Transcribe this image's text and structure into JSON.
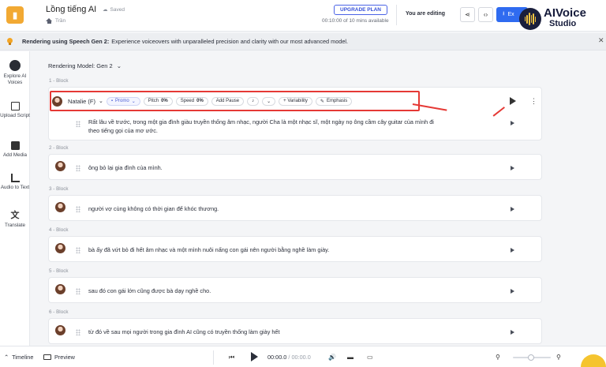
{
  "header": {
    "project_title": "Lồng tiếng AI",
    "saved_label": "Saved",
    "breadcrumb": "Trần",
    "upgrade_label": "UPGRADE PLAN",
    "quota": "00:10:00 of 10 mins available",
    "editing_label": "You are editing",
    "export_label": "Ex",
    "brand_line1": "AIVoice",
    "brand_line2": "Studio"
  },
  "notice": {
    "bold": "Rendering using Speech Gen 2:",
    "text": "Experience voiceovers with unparalleled precision and clarity with our most advanced model."
  },
  "sidebar": {
    "items": [
      {
        "label": "Explore AI Voices"
      },
      {
        "label": "Upload Script"
      },
      {
        "label": "Add Media"
      },
      {
        "label": "Audio to Text"
      },
      {
        "label": "Translate"
      }
    ]
  },
  "main": {
    "rendering_model": "Rendering Model: Gen 2",
    "toolbar": {
      "voice": "Natalie (F)",
      "style": "Promo",
      "pitch_label": "Pitch",
      "pitch_value": "0%",
      "speed_label": "Speed",
      "speed_value": "0%",
      "add_pause": "Add Pause",
      "variability": "+ Variability",
      "emphasis": "Emphasis"
    },
    "blocks": [
      {
        "label": "1 -  Block",
        "text_line1": "Rất lâu về trước, trong một gia đình giàu truyền thống âm nhạc, người Cha là một nhạc sĩ, một ngày nọ ông cầm cây guitar của mình đi",
        "text_line2": "theo tiếng gọi của mơ ước."
      },
      {
        "label": "2 -  Block",
        "text_line1": "ông bỏ lại gia đình của mình."
      },
      {
        "label": "3 -  Block",
        "text_line1": "người vợ cùng không có thời gian để khóc thương."
      },
      {
        "label": "4 -  Block",
        "text_line1": "bà ấy đã vứt bỏ đi hết âm nhạc và một mình nuôi nấng con gái nên người bằng nghề làm giày."
      },
      {
        "label": "5 -  Block",
        "text_line1": "sau đó con gái lớn cũng được bà dạy nghề cho."
      },
      {
        "label": "6 -  Block",
        "text_line1": "từ đó về sau mọi người trong gia đình AI cũng có truyền thống làm giày hết"
      }
    ]
  },
  "bottom": {
    "timeline": "Timeline",
    "preview": "Preview",
    "time_current": "00:00.0",
    "time_total": "/ 00:00.0"
  },
  "colors": {
    "accent": "#2f6bf0",
    "annotation_red": "#e53935",
    "warning": "#f3a524"
  }
}
